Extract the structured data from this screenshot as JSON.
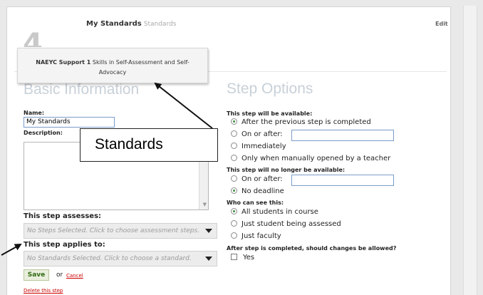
{
  "step": {
    "number": "4",
    "title": "My Standards",
    "subtitle": "Standards",
    "edit_label": "Edit"
  },
  "tooltip": {
    "code": "NAEYC Support 1",
    "text": "Skills in Self-Assessment and Self-Advocacy"
  },
  "basic_info": {
    "heading": "Basic Information",
    "name_label": "Name:",
    "name_value": "My Standards",
    "description_label": "Description:",
    "assesses_heading": "This step assesses:",
    "assesses_placeholder": "No Steps Selected. Click to choose assessment steps.",
    "applies_heading": "This step applies to:",
    "applies_placeholder": "No Standards Selected. Click to choose a standard.",
    "save_label": "Save",
    "or_label": "or",
    "cancel_label": "Cancel",
    "delete_label": "Delete this step"
  },
  "step_options": {
    "heading": "Step Options",
    "available_label": "This step will be available:",
    "available_options": [
      {
        "label": "After the previous step is completed",
        "selected": true
      },
      {
        "label": "On or after:",
        "selected": false
      },
      {
        "label": "Immediately",
        "selected": false
      },
      {
        "label": "Only when manually opened by a teacher",
        "selected": false
      }
    ],
    "unavailable_label": "This step will no longer be available:",
    "unavailable_options": [
      {
        "label": "On or after:",
        "selected": false
      },
      {
        "label": "No deadline",
        "selected": true
      }
    ],
    "who_label": "Who can see this:",
    "who_options": [
      {
        "label": "All students in course",
        "selected": true
      },
      {
        "label": "Just student being assessed",
        "selected": false
      },
      {
        "label": "Just faculty",
        "selected": false
      }
    ],
    "changes_label": "After step is completed, should changes be allowed?",
    "changes_option": {
      "label": "Yes",
      "checked": false
    }
  },
  "annotation": {
    "callout_text": "Standards"
  },
  "colors": {
    "heading_gray": "#c8d0d8",
    "radio_selected": "#3b8a3b",
    "link_red": "#cc0000",
    "save_green": "#2f6a12"
  }
}
